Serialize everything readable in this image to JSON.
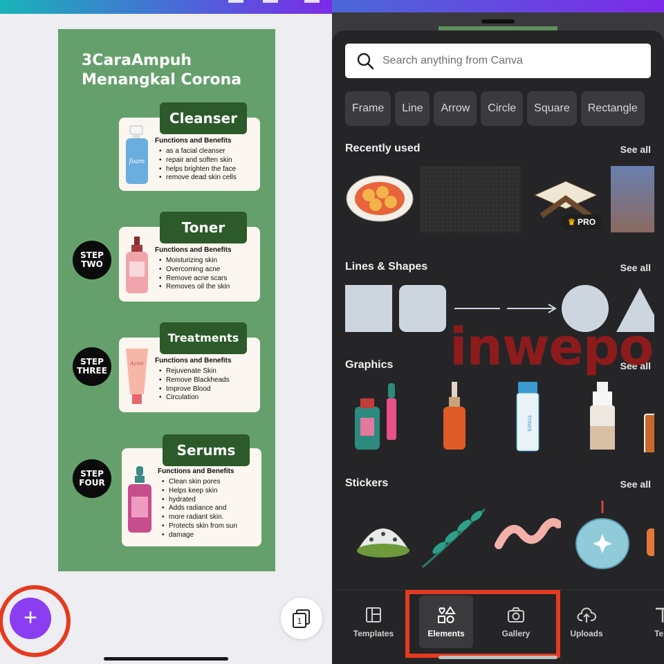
{
  "design": {
    "title_line1": "3CaraAmpuh",
    "title_line2": "Menangkal Corona",
    "steps": [
      {
        "heading": "Cleanser",
        "step_word": "",
        "step_number": "",
        "fb_title": "Functions and Benefits",
        "bullets": [
          "as a facial cleanser",
          "repair and soften skin",
          "helps brighten the face",
          "remove dead skin cells"
        ]
      },
      {
        "heading": "Toner",
        "step_word": "STEP",
        "step_number": "TWO",
        "fb_title": "Functions and Benefits",
        "bullets": [
          "Moisturizing skin",
          "Overcoming acne",
          "Remove acne scars",
          "Removes oil the skin"
        ]
      },
      {
        "heading": "Treatments",
        "step_word": "STEP",
        "step_number": "THREE",
        "fb_title": "Functions and Benefits",
        "bullets": [
          "Rejuvenate Skin",
          "Remove Blackheads",
          "Improve Blood",
          "Circulation"
        ]
      },
      {
        "heading": "Serums",
        "step_word": "STEP",
        "step_number": "FOUR",
        "fb_title": "Functions and Benefits",
        "bullets": [
          "Clean skin pores",
          "Helps keep skin",
          "hydrated",
          "Adds radiance and",
          "more radiant skin.",
          "Protects skin from sun",
          "damage"
        ]
      }
    ]
  },
  "fab": {
    "icon": "plus-icon",
    "label": "+"
  },
  "pages_button": {
    "icon": "pages-icon",
    "count": "1"
  },
  "panel": {
    "search_placeholder": "Search anything from Canva",
    "chips": [
      "Frame",
      "Line",
      "Arrow",
      "Circle",
      "Square",
      "Rectangle"
    ],
    "sections": {
      "recently_used": {
        "title": "Recently used",
        "see_all": "See all",
        "pro_badge": "PRO"
      },
      "lines_shapes": {
        "title": "Lines & Shapes",
        "see_all": "See all"
      },
      "graphics": {
        "title": "Graphics",
        "see_all": "See all",
        "toner_label": "TONER"
      },
      "stickers": {
        "title": "Stickers",
        "see_all": "See all"
      }
    },
    "nav": [
      {
        "label": "Templates",
        "icon": "templates-icon"
      },
      {
        "label": "Elements",
        "icon": "elements-icon",
        "active": true
      },
      {
        "label": "Gallery",
        "icon": "camera-icon"
      },
      {
        "label": "Uploads",
        "icon": "cloud-upload-icon"
      },
      {
        "label": "Text",
        "icon": "text-icon"
      }
    ]
  },
  "watermark": "inwepo",
  "colors": {
    "accent": "#8b3df1",
    "highlight": "#e53a1f",
    "design_bg": "#65a06c",
    "pill": "#2c5a2a",
    "panel_bg": "#252528"
  }
}
